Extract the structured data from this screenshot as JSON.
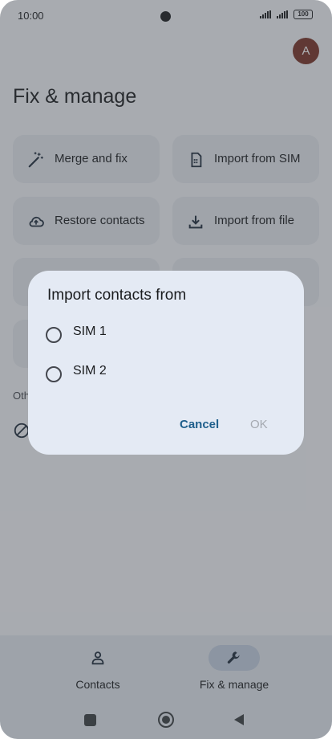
{
  "status": {
    "time": "10:00",
    "battery": "100"
  },
  "header": {
    "avatar_letter": "A",
    "title": "Fix & manage"
  },
  "cards": [
    {
      "label": "Merge and fix",
      "icon": "magic-wand-icon"
    },
    {
      "label": "Import from SIM",
      "icon": "sim-card-icon"
    },
    {
      "label": "Restore contacts",
      "icon": "cloud-restore-icon"
    },
    {
      "label": "Import from file",
      "icon": "download-icon"
    }
  ],
  "other": {
    "label": "Oth"
  },
  "dialog": {
    "title": "Import contacts from",
    "options": [
      {
        "label": "SIM 1"
      },
      {
        "label": "SIM 2"
      }
    ],
    "cancel_label": "Cancel",
    "ok_label": "OK"
  },
  "bottom_nav": {
    "items": [
      {
        "label": "Contacts",
        "icon": "person-icon",
        "active": false
      },
      {
        "label": "Fix & manage",
        "icon": "wrench-icon",
        "active": true
      }
    ]
  },
  "colors": {
    "accent": "#1e5f8c",
    "avatar": "#7a3326",
    "dialog_bg": "#e4eaf4"
  }
}
